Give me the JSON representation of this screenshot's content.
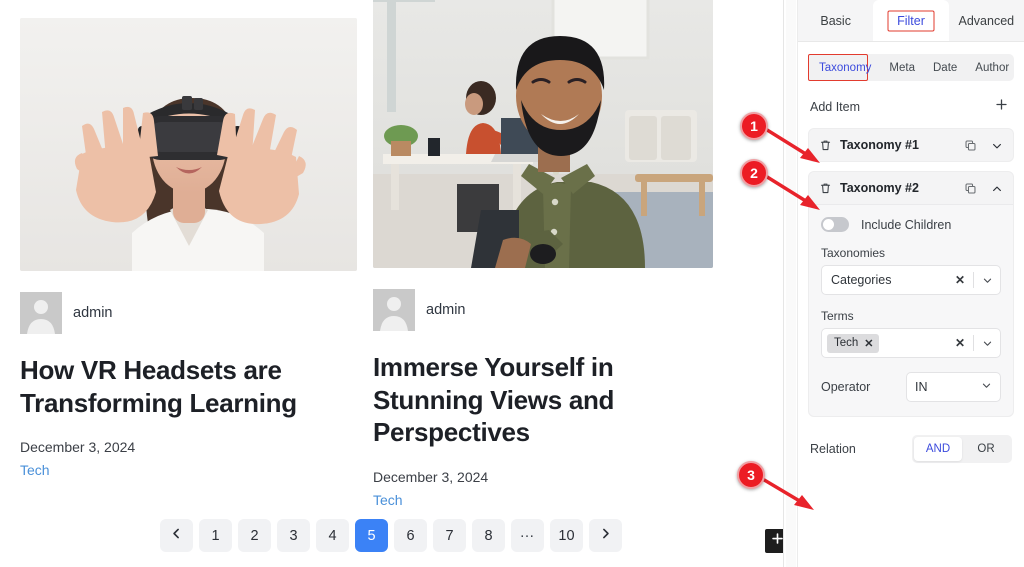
{
  "preview": {
    "posts": [
      {
        "image_alt": "woman-wearing-vr-headset-hands-raised",
        "author": "admin",
        "title": "How VR Headsets are Transforming Learning",
        "date": "December 3, 2024",
        "category": "Tech"
      },
      {
        "image_alt": "smiling-bearded-man-in-office-at-laptop",
        "author": "admin",
        "title": "Immerse Yourself in Stunning Views and Perspectives",
        "date": "December 3, 2024",
        "category": "Tech"
      }
    ],
    "pagination": {
      "prev_icon": "chevron-left-icon",
      "next_icon": "chevron-right-icon",
      "pages": [
        "1",
        "2",
        "3",
        "4",
        "5",
        "6",
        "7",
        "8",
        "…",
        "10"
      ],
      "current": "5"
    },
    "fab": {
      "icon": "plus-icon"
    }
  },
  "panel": {
    "tabs": [
      {
        "label": "Basic",
        "active": false,
        "annotated": false
      },
      {
        "label": "Filter",
        "active": true,
        "annotated": true
      },
      {
        "label": "Advanced",
        "active": false,
        "annotated": false
      }
    ],
    "subtabs": [
      {
        "label": "Taxonomy",
        "active": true,
        "annotated": true
      },
      {
        "label": "Meta",
        "active": false,
        "annotated": false
      },
      {
        "label": "Date",
        "active": false,
        "annotated": false
      },
      {
        "label": "Author",
        "active": false,
        "annotated": false
      }
    ],
    "add_item": {
      "label": "Add Item",
      "icon": "plus-icon"
    },
    "items": [
      {
        "title": "Taxonomy #1",
        "expanded": false,
        "delete_icon": "trash-icon",
        "duplicate_icon": "copy-icon",
        "chevron_icon": "chevron-down-icon"
      },
      {
        "title": "Taxonomy #2",
        "expanded": true,
        "delete_icon": "trash-icon",
        "duplicate_icon": "copy-icon",
        "chevron_icon": "chevron-up-icon",
        "include_children": {
          "label": "Include Children",
          "on": false
        },
        "taxonomies": {
          "label": "Taxonomies",
          "value": "Categories",
          "clear": "✕"
        },
        "terms": {
          "label": "Terms",
          "chips": [
            "Tech"
          ],
          "chip_remove": "✕",
          "clear": "✕"
        },
        "operator": {
          "label": "Operator",
          "value": "IN"
        }
      }
    ],
    "relation": {
      "label": "Relation",
      "options": [
        "AND",
        "OR"
      ],
      "selected": "AND"
    }
  },
  "annotations": [
    {
      "number": "1",
      "target": "taxonomy-item-1"
    },
    {
      "number": "2",
      "target": "taxonomy-item-2"
    },
    {
      "number": "3",
      "target": "relation-row"
    }
  ],
  "colors": {
    "accent_blue": "#3b82f6",
    "link_blue": "#4a90d9",
    "tab_active_text": "#3c4bdd",
    "annotation_red": "#ec1c24"
  }
}
